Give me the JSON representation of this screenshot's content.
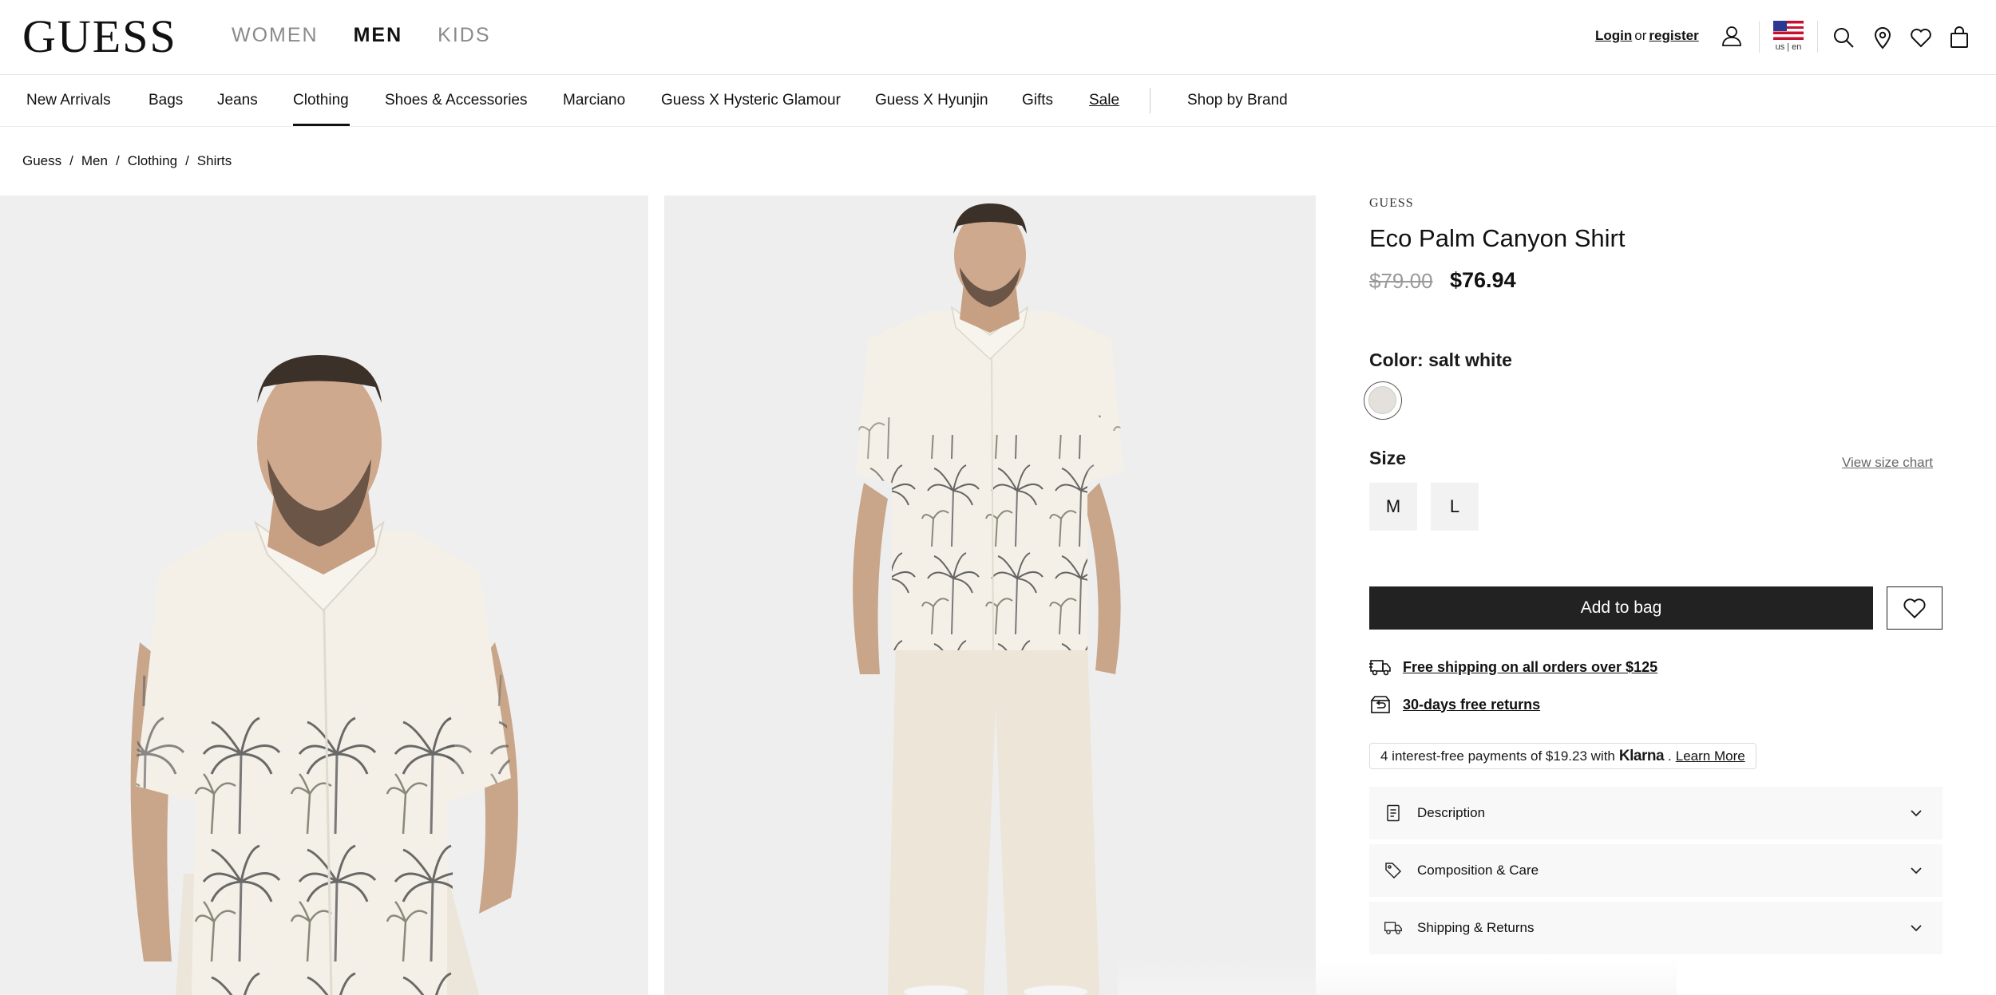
{
  "header": {
    "logo": "GUESS",
    "gender_tabs": [
      {
        "label": "WOMEN",
        "active": false
      },
      {
        "label": "MEN",
        "active": true
      },
      {
        "label": "KIDS",
        "active": false
      }
    ],
    "login_label": "Login",
    "or_label": "or",
    "register_label": "register",
    "locale_label": "us | en",
    "icons": [
      "user-icon",
      "us-flag-icon",
      "search-icon",
      "store-locator-icon",
      "heart-icon",
      "bag-icon"
    ]
  },
  "category_nav": {
    "items": [
      "New Arrivals",
      "Bags",
      "Jeans",
      "Clothing",
      "Shoes & Accessories",
      "Marciano",
      "Guess X Hysteric Glamour",
      "Guess X Hyunjin",
      "Gifts",
      "Sale",
      "Shop by Brand"
    ],
    "active": "Clothing"
  },
  "breadcrumb": {
    "items": [
      "Guess",
      "Men",
      "Clothing",
      "Shirts"
    ],
    "separator": "/"
  },
  "product": {
    "brand": "GUESS",
    "title": "Eco Palm Canyon Shirt",
    "price_original": "$79.00",
    "price_sale": "$76.94",
    "color_label": "Color: salt white",
    "swatch_color": "#e4e1dc",
    "size_label": "Size",
    "size_chart_label": "View size chart",
    "sizes": [
      "M",
      "L"
    ],
    "add_to_bag_label": "Add to bag",
    "perks": [
      {
        "icon": "truck-icon",
        "label": "Free shipping on all orders over $125"
      },
      {
        "icon": "return-box-icon",
        "label": "30-days free returns"
      }
    ],
    "klarna": {
      "text_prefix": "4 interest-free payments of $19.23 with",
      "brand": "Klarna",
      "dot": ".",
      "learn_more": "Learn More"
    },
    "accordions": [
      {
        "icon": "document-icon",
        "label": "Description"
      },
      {
        "icon": "tag-icon",
        "label": "Composition & Care"
      },
      {
        "icon": "truck-icon",
        "label": "Shipping & Returns"
      }
    ]
  },
  "colors": {
    "primary_button": "#222222",
    "text": "#111111",
    "muted": "#9a9a9a"
  }
}
